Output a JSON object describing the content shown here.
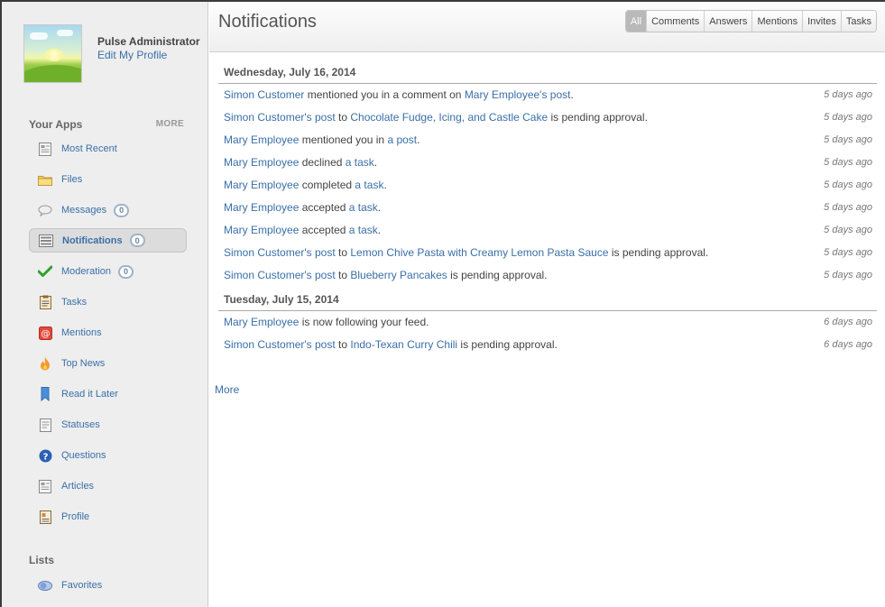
{
  "profile": {
    "name": "Pulse Administrator",
    "edit_link": "Edit My Profile"
  },
  "sidebar": {
    "apps_heading": "Your Apps",
    "more_label": "MORE",
    "items": [
      {
        "label": "Most Recent",
        "icon": "most-recent-icon"
      },
      {
        "label": "Files",
        "icon": "folder-icon"
      },
      {
        "label": "Messages",
        "icon": "speech-bubble-icon",
        "badge": "0"
      },
      {
        "label": "Notifications",
        "icon": "notifications-icon",
        "badge": "0",
        "active": true
      },
      {
        "label": "Moderation",
        "icon": "checkmark-icon",
        "badge": "0"
      },
      {
        "label": "Tasks",
        "icon": "clipboard-icon"
      },
      {
        "label": "Mentions",
        "icon": "at-sign-icon"
      },
      {
        "label": "Top News",
        "icon": "flame-icon"
      },
      {
        "label": "Read it Later",
        "icon": "bookmark-icon"
      },
      {
        "label": "Statuses",
        "icon": "statuses-icon"
      },
      {
        "label": "Questions",
        "icon": "question-icon"
      },
      {
        "label": "Articles",
        "icon": "article-icon"
      },
      {
        "label": "Profile",
        "icon": "profile-card-icon"
      }
    ],
    "lists_heading": "Lists",
    "lists": [
      {
        "label": "Favorites",
        "icon": "favorites-icon"
      }
    ]
  },
  "header": {
    "title": "Notifications",
    "filters": [
      "All",
      "Comments",
      "Answers",
      "Mentions",
      "Invites",
      "Tasks"
    ],
    "active_filter": "All"
  },
  "feed": {
    "days": [
      {
        "date": "Wednesday, July 16, 2014",
        "items": [
          {
            "parts": [
              {
                "t": "Simon Customer",
                "link": true
              },
              {
                "t": " mentioned you in a comment on "
              },
              {
                "t": "Mary Employee's post",
                "link": true
              },
              {
                "t": "."
              }
            ],
            "time": "5 days ago"
          },
          {
            "parts": [
              {
                "t": "Simon Customer's post",
                "link": true
              },
              {
                "t": " to "
              },
              {
                "t": "Chocolate Fudge, Icing, and Castle Cake",
                "link": true
              },
              {
                "t": " is pending approval."
              }
            ],
            "time": "5 days ago"
          },
          {
            "parts": [
              {
                "t": "Mary Employee",
                "link": true
              },
              {
                "t": " mentioned you in "
              },
              {
                "t": "a post",
                "link": true
              },
              {
                "t": "."
              }
            ],
            "time": "5 days ago"
          },
          {
            "parts": [
              {
                "t": "Mary Employee",
                "link": true
              },
              {
                "t": " declined "
              },
              {
                "t": "a task",
                "link": true
              },
              {
                "t": "."
              }
            ],
            "time": "5 days ago"
          },
          {
            "parts": [
              {
                "t": "Mary Employee",
                "link": true
              },
              {
                "t": " completed "
              },
              {
                "t": "a task",
                "link": true
              },
              {
                "t": "."
              }
            ],
            "time": "5 days ago"
          },
          {
            "parts": [
              {
                "t": "Mary Employee",
                "link": true
              },
              {
                "t": " accepted "
              },
              {
                "t": "a task",
                "link": true
              },
              {
                "t": "."
              }
            ],
            "time": "5 days ago"
          },
          {
            "parts": [
              {
                "t": "Mary Employee",
                "link": true
              },
              {
                "t": " accepted "
              },
              {
                "t": "a task",
                "link": true
              },
              {
                "t": "."
              }
            ],
            "time": "5 days ago"
          },
          {
            "parts": [
              {
                "t": "Simon Customer's post",
                "link": true
              },
              {
                "t": " to "
              },
              {
                "t": "Lemon Chive Pasta with Creamy Lemon Pasta Sauce",
                "link": true
              },
              {
                "t": " is pending approval."
              }
            ],
            "time": "5 days ago"
          },
          {
            "parts": [
              {
                "t": "Simon Customer's post",
                "link": true
              },
              {
                "t": " to "
              },
              {
                "t": "Blueberry Pancakes",
                "link": true
              },
              {
                "t": " is pending approval."
              }
            ],
            "time": "5 days ago"
          }
        ]
      },
      {
        "date": "Tuesday, July 15, 2014",
        "items": [
          {
            "parts": [
              {
                "t": "Mary Employee",
                "link": true
              },
              {
                "t": " is now following your feed."
              }
            ],
            "time": "6 days ago"
          },
          {
            "parts": [
              {
                "t": "Simon Customer's post",
                "link": true
              },
              {
                "t": " to "
              },
              {
                "t": "Indo-Texan Curry Chili",
                "link": true
              },
              {
                "t": " is pending approval."
              }
            ],
            "time": "6 days ago"
          }
        ]
      }
    ],
    "more_label": "More"
  },
  "colors": {
    "link": "#3a6fa8",
    "sidebar_bg": "#eeeeee",
    "active_filter_bg": "#b9b9b9"
  }
}
